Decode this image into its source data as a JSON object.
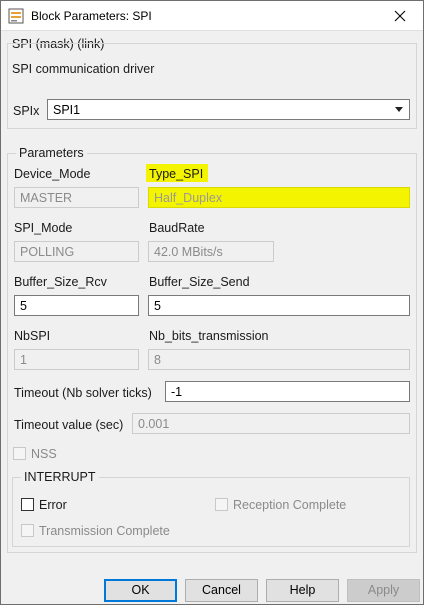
{
  "window": {
    "title": "Block Parameters: SPI"
  },
  "mask": {
    "header": "SPI (mask) (link)",
    "description": "SPI communication driver",
    "spix_label": "SPIx",
    "spix_value": "SPI1"
  },
  "parameters": {
    "title": "Parameters",
    "device_mode_label": "Device_Mode",
    "device_mode_value": "MASTER",
    "type_spi_label": "Type_SPI",
    "type_spi_value": "Half_Duplex",
    "spi_mode_label": "SPI_Mode",
    "spi_mode_value": "POLLING",
    "baudrate_label": "BaudRate",
    "baudrate_value": "42.0 MBits/s",
    "buffer_rcv_label": "Buffer_Size_Rcv",
    "buffer_rcv_value": "5",
    "buffer_send_label": "Buffer_Size_Send",
    "buffer_send_value": "5",
    "nbspi_label": "NbSPI",
    "nbspi_value": "1",
    "nb_bits_label": "Nb_bits_transmission",
    "nb_bits_value": "8",
    "timeout_label": "Timeout (Nb solver ticks)",
    "timeout_value": "-1",
    "timeout_sec_label": "Timeout value (sec)",
    "timeout_sec_value": "0.001",
    "nss_label": "NSS"
  },
  "interrupt": {
    "title": "INTERRUPT",
    "error_label": "Error",
    "reception_label": "Reception Complete",
    "transmission_label": "Transmission Complete"
  },
  "buttons": {
    "ok": "OK",
    "cancel": "Cancel",
    "help": "Help",
    "apply": "Apply"
  },
  "colors": {
    "highlight": "#f4f400",
    "default_button_border": "#0078d7"
  }
}
